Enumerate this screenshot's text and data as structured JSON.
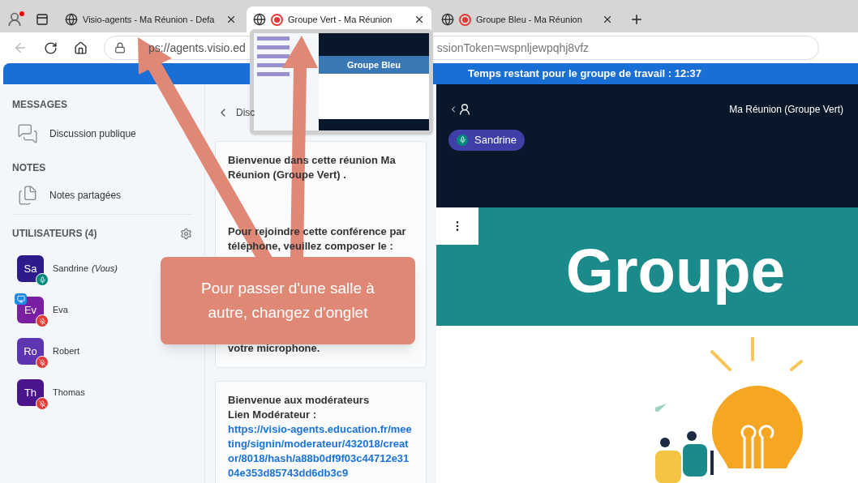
{
  "browser": {
    "tabs": [
      {
        "title": "Visio-agents - Ma Réunion - Defa",
        "recording": false,
        "selected": false
      },
      {
        "title": "Groupe Vert - Ma Réunion",
        "recording": true,
        "selected": true
      },
      {
        "title": "Groupe Bleu - Ma Réunion",
        "recording": true,
        "selected": false
      }
    ],
    "url_start": "ps://agents.visio.ed",
    "url_end": "ssionToken=wspnljewpqhj8vfz",
    "tab_preview": {
      "heading": "Groupe Bleu"
    }
  },
  "timer": "Temps restant pour le groupe de travail : 12:37",
  "sidebar": {
    "messages_heading": "MESSAGES",
    "chat_item": "Discussion publique",
    "notes_heading": "NOTES",
    "notes_item": "Notes partagées",
    "users_heading": "UTILISATEURS (4)",
    "users": [
      {
        "initials": "Sa",
        "name": "Sandrine",
        "suffix": "(Vous)",
        "color": "#2d1b8c",
        "muted": false,
        "presenter": false
      },
      {
        "initials": "Ev",
        "name": "Eva",
        "color": "#7b1fa2",
        "muted": true,
        "presenter": true
      },
      {
        "initials": "Ro",
        "name": "Robert",
        "color": "#5e35b1",
        "muted": true,
        "presenter": false
      },
      {
        "initials": "Th",
        "name": "Thomas",
        "color": "#4a148c",
        "muted": true,
        "presenter": false
      }
    ]
  },
  "chat": {
    "header": "Disc",
    "cards": [
      {
        "paragraphs": [
          "Bienvenue dans cette réunion **Ma Réunion (Groupe Vert)** .",
          "Pour rejoindre cette conférence par téléphone, veuillez composer le :",
          "votre microphone."
        ]
      },
      {
        "paragraphs": [
          "Bienvenue aux modérateurs"
        ],
        "link_label": "Lien Modérateur  : ",
        "link": "https://visio-agents.education.fr/meeting/signin/moderateur/432018/creator/8018/hash/a88b0df9f03c44712e3104e353d85743dd6db3c9"
      }
    ]
  },
  "meeting": {
    "title": "Ma Réunion (Groupe Vert)",
    "talker": "Sandrine",
    "slide_title": "Groupe"
  },
  "callout": "Pour passer d'une salle à autre, changez d'onglet"
}
